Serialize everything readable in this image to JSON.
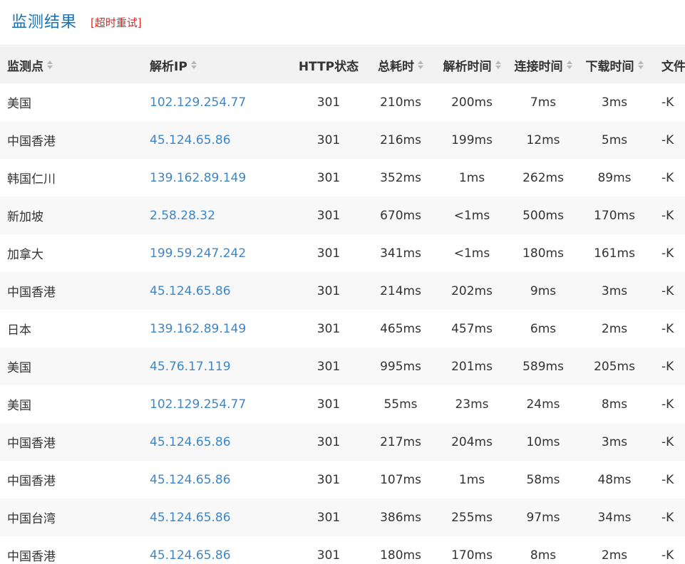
{
  "header": {
    "title": "监测结果",
    "retry_label": "[超时重试]"
  },
  "table": {
    "columns": {
      "node": "监测点",
      "ip": "解析IP",
      "http": "HTTP状态",
      "total": "总耗时",
      "dns": "解析时间",
      "connect": "连接时间",
      "download": "下载时间",
      "file": "文件"
    },
    "rows": [
      {
        "node": "美国",
        "ip": "102.129.254.77",
        "http": "301",
        "total": "210ms",
        "dns": "200ms",
        "connect": "7ms",
        "download": "3ms",
        "file": "-K"
      },
      {
        "node": "中国香港",
        "ip": "45.124.65.86",
        "http": "301",
        "total": "216ms",
        "dns": "199ms",
        "connect": "12ms",
        "download": "5ms",
        "file": "-K"
      },
      {
        "node": "韩国仁川",
        "ip": "139.162.89.149",
        "http": "301",
        "total": "352ms",
        "dns": "1ms",
        "connect": "262ms",
        "download": "89ms",
        "file": "-K"
      },
      {
        "node": "新加坡",
        "ip": "2.58.28.32",
        "http": "301",
        "total": "670ms",
        "dns": "<1ms",
        "connect": "500ms",
        "download": "170ms",
        "file": "-K"
      },
      {
        "node": "加拿大",
        "ip": "199.59.247.242",
        "http": "301",
        "total": "341ms",
        "dns": "<1ms",
        "connect": "180ms",
        "download": "161ms",
        "file": "-K"
      },
      {
        "node": "中国香港",
        "ip": "45.124.65.86",
        "http": "301",
        "total": "214ms",
        "dns": "202ms",
        "connect": "9ms",
        "download": "3ms",
        "file": "-K"
      },
      {
        "node": "日本",
        "ip": "139.162.89.149",
        "http": "301",
        "total": "465ms",
        "dns": "457ms",
        "connect": "6ms",
        "download": "2ms",
        "file": "-K"
      },
      {
        "node": "美国",
        "ip": "45.76.17.119",
        "http": "301",
        "total": "995ms",
        "dns": "201ms",
        "connect": "589ms",
        "download": "205ms",
        "file": "-K"
      },
      {
        "node": "美国",
        "ip": "102.129.254.77",
        "http": "301",
        "total": "55ms",
        "dns": "23ms",
        "connect": "24ms",
        "download": "8ms",
        "file": "-K"
      },
      {
        "node": "中国香港",
        "ip": "45.124.65.86",
        "http": "301",
        "total": "217ms",
        "dns": "204ms",
        "connect": "10ms",
        "download": "3ms",
        "file": "-K"
      },
      {
        "node": "中国香港",
        "ip": "45.124.65.86",
        "http": "301",
        "total": "107ms",
        "dns": "1ms",
        "connect": "58ms",
        "download": "48ms",
        "file": "-K"
      },
      {
        "node": "中国台湾",
        "ip": "45.124.65.86",
        "http": "301",
        "total": "386ms",
        "dns": "255ms",
        "connect": "97ms",
        "download": "34ms",
        "file": "-K"
      },
      {
        "node": "中国香港",
        "ip": "45.124.65.86",
        "http": "301",
        "total": "180ms",
        "dns": "170ms",
        "connect": "8ms",
        "download": "2ms",
        "file": "-K"
      }
    ]
  },
  "colors": {
    "title": "#1a73b8",
    "retry": "#d9261c",
    "ip_link": "#3d86c8",
    "header_bg": "#f2f2f2",
    "stripe_bg": "#f8f8f8"
  }
}
